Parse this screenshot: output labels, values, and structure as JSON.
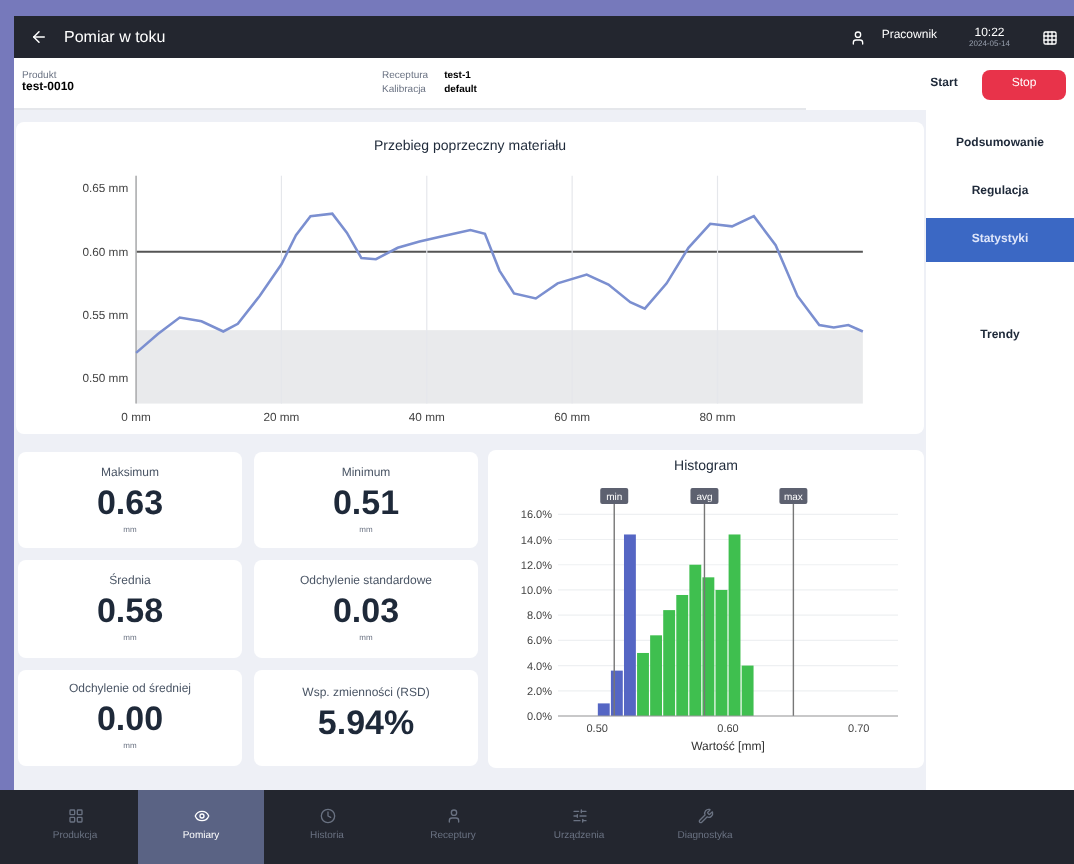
{
  "top_bar": {
    "title": "Pomiar w toku",
    "user": "Pracownik",
    "time": "10:22",
    "date": "2024-05-14"
  },
  "header": {
    "fields": [
      {
        "label": "Produkt",
        "value": "test-0010"
      },
      {
        "label": "Receptura",
        "value": "test-1"
      },
      {
        "label": "Kalibracja",
        "value": "default"
      }
    ],
    "buttons": [
      {
        "label": "Start",
        "kind": "plain"
      },
      {
        "label": "Stop",
        "kind": "danger"
      }
    ]
  },
  "profile_chart": {
    "chart_data": {
      "type": "line",
      "title": "Przebieg poprzeczny materiału",
      "xlim": [
        0,
        100
      ],
      "ylim": [
        0.48,
        0.66
      ],
      "xticks": [
        {
          "value": 0,
          "label": "0 mm"
        },
        {
          "value": 20,
          "label": "20 mm"
        },
        {
          "value": 40,
          "label": "40 mm"
        },
        {
          "value": 60,
          "label": "60 mm"
        },
        {
          "value": 80,
          "label": "80 mm"
        }
      ],
      "yticks": [
        {
          "value": 0.5,
          "label": "0.50 mm"
        },
        {
          "value": 0.55,
          "label": "0.55 mm"
        },
        {
          "value": 0.6,
          "label": "0.60 mm"
        },
        {
          "value": 0.65,
          "label": "0.65 mm"
        }
      ],
      "x": [
        0,
        3,
        6,
        9,
        12,
        14,
        17,
        20,
        22,
        24,
        27,
        29,
        31,
        33,
        36,
        39,
        42,
        46,
        48,
        50,
        52,
        55,
        58,
        62,
        65,
        68,
        70,
        73,
        76,
        79,
        82,
        85,
        88,
        91,
        94,
        96,
        98,
        100
      ],
      "series": [
        {
          "color": "#7b8fd0",
          "values": [
            0.52,
            0.535,
            0.548,
            0.545,
            0.537,
            0.543,
            0.565,
            0.59,
            0.613,
            0.628,
            0.63,
            0.615,
            0.595,
            0.594,
            0.603,
            0.608,
            0.612,
            0.617,
            0.614,
            0.585,
            0.567,
            0.563,
            0.575,
            0.582,
            0.574,
            0.56,
            0.555,
            0.575,
            0.603,
            0.622,
            0.62,
            0.628,
            0.605,
            0.565,
            0.542,
            0.54,
            0.542,
            0.537
          ]
        }
      ],
      "grid": true,
      "bands": [
        {
          "axis": "y",
          "from": 0.48,
          "to": 0.538
        }
      ],
      "ref_lines": [
        {
          "axis": "y",
          "value": 0.6
        }
      ]
    }
  },
  "stats": [
    {
      "label": "Maksimum",
      "value": "0.63",
      "unit": "mm"
    },
    {
      "label": "Minimum",
      "value": "0.51",
      "unit": "mm"
    },
    {
      "label": "Średnia",
      "value": "0.58",
      "unit": "mm"
    },
    {
      "label": "Odchylenie standardowe",
      "value": "0.03",
      "unit": "mm"
    },
    {
      "label": "Odchylenie od średniej",
      "value": "0.00",
      "unit": "mm"
    },
    {
      "label": "Wsp. zmienności (RSD)",
      "value": "5.94%"
    }
  ],
  "histogram": {
    "chart_data": {
      "type": "bar",
      "stacked": true,
      "title": "Histogram",
      "xlabel": "Wartość [mm]",
      "xlim": [
        0.47,
        0.73
      ],
      "ylim": [
        0,
        16.5
      ],
      "xticks": [
        {
          "value": 0.5,
          "label": "0.50"
        },
        {
          "value": 0.6,
          "label": "0.60"
        },
        {
          "value": 0.7,
          "label": "0.70"
        }
      ],
      "yticks": [
        {
          "value": 0,
          "label": "0.0%"
        },
        {
          "value": 2,
          "label": "2.0%"
        },
        {
          "value": 4,
          "label": "4.0%"
        },
        {
          "value": 6,
          "label": "6.0%"
        },
        {
          "value": 8,
          "label": "8.0%"
        },
        {
          "value": 10,
          "label": "10.0%"
        },
        {
          "value": 12,
          "label": "12.0%"
        },
        {
          "value": 14,
          "label": "14.0%"
        },
        {
          "value": 16,
          "label": "16.0%"
        }
      ],
      "x": [
        0.505,
        0.515,
        0.525,
        0.535,
        0.545,
        0.555,
        0.565,
        0.575,
        0.585,
        0.595,
        0.605,
        0.615
      ],
      "series": [
        {
          "color": "#5566c4",
          "values": [
            1.0,
            3.6,
            14.4,
            null,
            null,
            null,
            null,
            null,
            null,
            null,
            null,
            null
          ]
        },
        {
          "color": "#3fbf4f",
          "values": [
            null,
            null,
            null,
            5.0,
            6.4,
            8.4,
            9.6,
            12.0,
            11.0,
            10.0,
            14.4,
            4.0
          ]
        }
      ],
      "grid": true,
      "ref_lines": [
        {
          "axis": "x",
          "value": 0.513,
          "label": "min"
        },
        {
          "axis": "x",
          "value": 0.582,
          "label": "avg"
        },
        {
          "axis": "x",
          "value": 0.65,
          "label": "max"
        }
      ]
    }
  },
  "side_menu": [
    {
      "label": "Podsumowanie",
      "selected": false
    },
    {
      "label": "Regulacja",
      "selected": false
    },
    {
      "label": "Statystyki",
      "selected": true
    },
    {
      "label": "Trendy",
      "selected": false
    }
  ],
  "bottom_nav": [
    {
      "label": "Produkcja",
      "selected": false
    },
    {
      "label": "Pomiary",
      "selected": true
    },
    {
      "label": "Historia",
      "selected": false
    },
    {
      "label": "Receptury",
      "selected": false
    },
    {
      "label": "Urządzenia",
      "selected": false
    },
    {
      "label": "Diagnostyka",
      "selected": false
    }
  ]
}
